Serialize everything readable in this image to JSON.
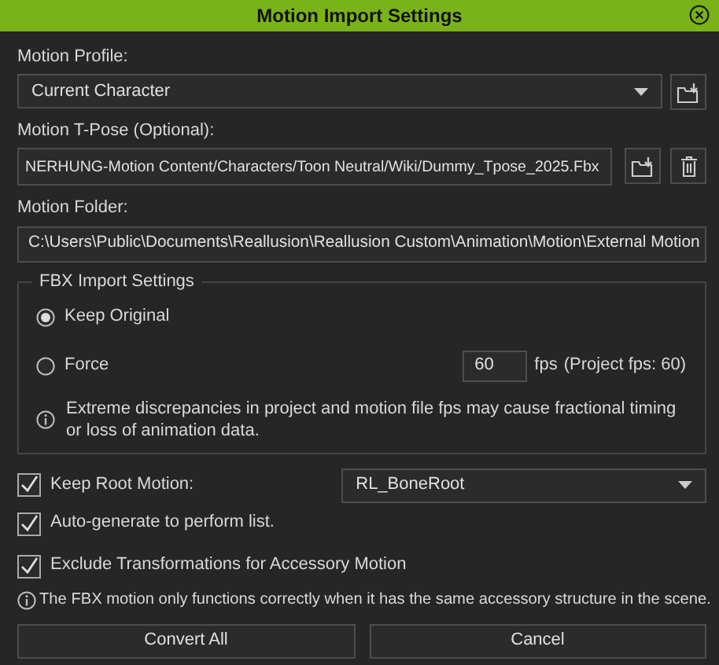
{
  "window": {
    "title": "Motion Import Settings"
  },
  "motion_profile": {
    "label": "Motion Profile:",
    "value": "Current Character"
  },
  "tpose": {
    "label": "Motion T-Pose (Optional):",
    "value": "NERHUNG-Motion Content/Characters/Toon Neutral/Wiki/Dummy_Tpose_2025.Fbx"
  },
  "motion_folder": {
    "label": "Motion Folder:",
    "value": "C:\\Users\\Public\\Documents\\Reallusion\\Reallusion Custom\\Animation\\Motion\\External Motion"
  },
  "fbx": {
    "legend": "FBX Import Settings",
    "options": [
      {
        "label": "Keep Original",
        "selected": true
      },
      {
        "label": "Force",
        "selected": false
      }
    ],
    "fps_value": "60",
    "fps_unit": "fps",
    "project_fps": "(Project fps: 60)",
    "note": "Extreme discrepancies in project and motion file fps may cause fractional timing or loss of animation data."
  },
  "options": [
    {
      "kind": "dropdown",
      "label": "Keep Root Motion:",
      "checked": true,
      "value": "RL_BoneRoot"
    },
    {
      "kind": "plain",
      "label": "Auto-generate to perform list.",
      "checked": true
    },
    {
      "kind": "plain",
      "label": "Exclude Transformations for Accessory Motion",
      "checked": true
    }
  ],
  "note": "The FBX motion only functions correctly when it has the same accessory structure in the scene.",
  "buttons": [
    "Convert All",
    "Cancel"
  ]
}
